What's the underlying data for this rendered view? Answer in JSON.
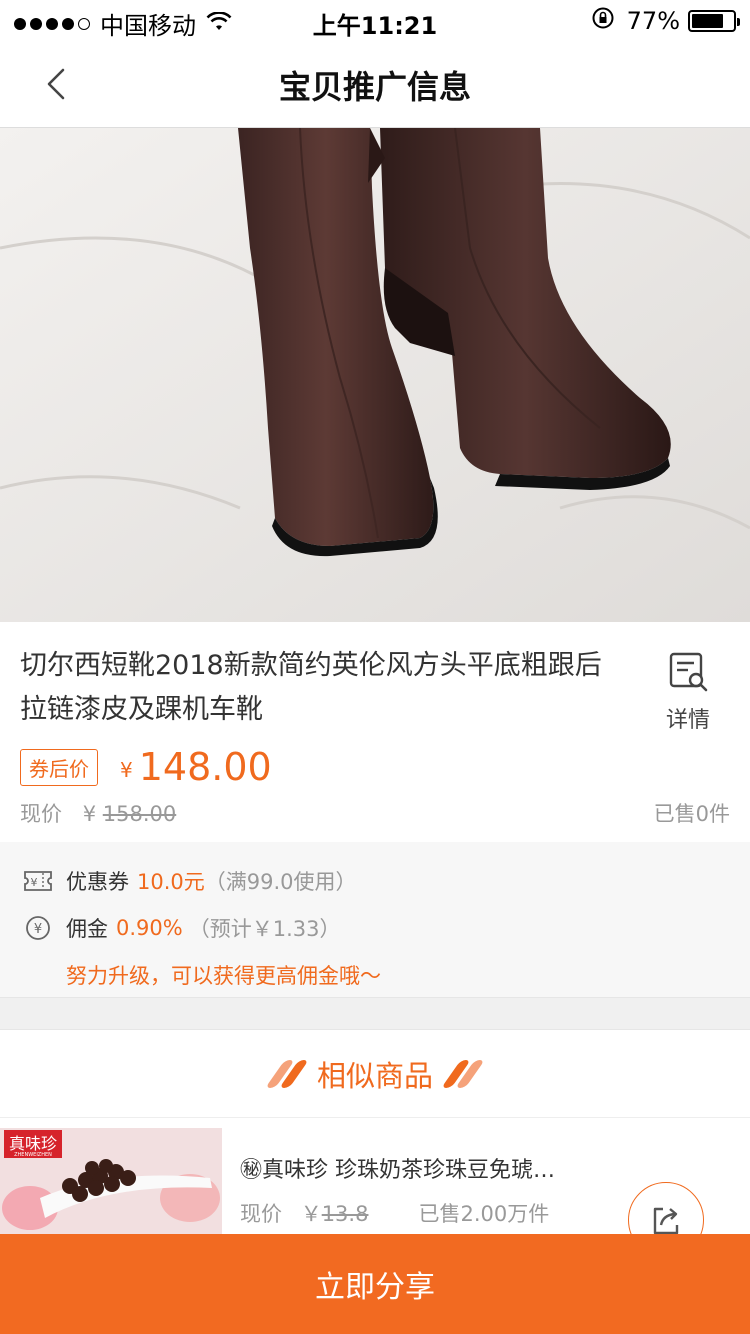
{
  "status_bar": {
    "carrier": "中国移动",
    "time": "上午11:21",
    "battery": "77%",
    "battery_level": 0.77
  },
  "nav": {
    "title": "宝贝推广信息",
    "back_icon": "chevron-left-icon"
  },
  "product": {
    "title": "切尔西短靴2018新款简约英伦风方头平底粗跟后拉链漆皮及踝机车靴",
    "detail_label": "详情",
    "coupon_price_tag": "券后价",
    "currency": "¥",
    "price": "148.00",
    "original_label": "现价",
    "original_price": "158.00",
    "sold": "已售0件"
  },
  "coupon": {
    "coupon_label": "优惠券",
    "coupon_value": "10.0元",
    "coupon_condition": "（满99.0使用）",
    "commission_label": "佣金",
    "commission_value": "0.90%",
    "commission_estimate": "（预计￥1.33）",
    "hint": "努力升级，可以获得更高佣金哦～"
  },
  "similar": {
    "heading": "相似商品",
    "items": [
      {
        "brand_logo": "真味珍",
        "brand_sub": "ZHENWEIZHEN",
        "title": "㊙真味珍 珍珠奶茶珍珠豆免琥…",
        "price_label": "现价",
        "currency": "￥",
        "price": "13.8",
        "sold": "已售2.00万件"
      }
    ]
  },
  "cta": {
    "label": "立即分享"
  },
  "colors": {
    "accent": "#f06a1e",
    "cta_bg": "#f26a21"
  }
}
